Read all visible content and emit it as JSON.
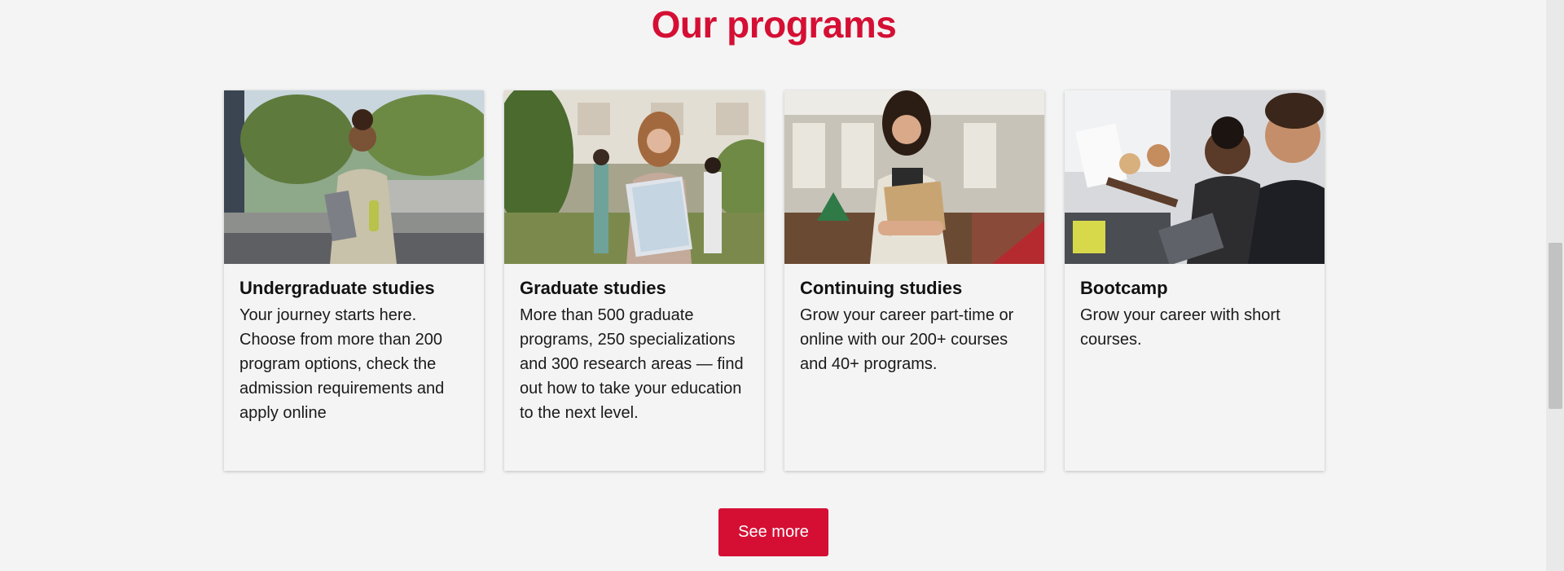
{
  "section": {
    "title": "Our programs"
  },
  "cards": [
    {
      "title": "Undergraduate studies",
      "text": "Your journey starts here. Choose from more than 200 program options, check the admission requirements and apply online",
      "image": "student-with-laptop-photo"
    },
    {
      "title": "Graduate studies",
      "text": "More than 500 graduate programs, 250 specializations and 300 research areas — find out how to take your education to the next level.",
      "image": "student-holding-notebooks-photo"
    },
    {
      "title": "Continuing studies",
      "text": "Grow your career part-time or online with our 200+ courses and 40+ programs.",
      "image": "student-in-library-photo"
    },
    {
      "title": "Bootcamp",
      "text": "Grow your career with short courses.",
      "image": "team-working-photo"
    }
  ],
  "cta": {
    "label": "See more"
  },
  "colors": {
    "accent": "#d50f34",
    "background": "#f4f4f4"
  }
}
